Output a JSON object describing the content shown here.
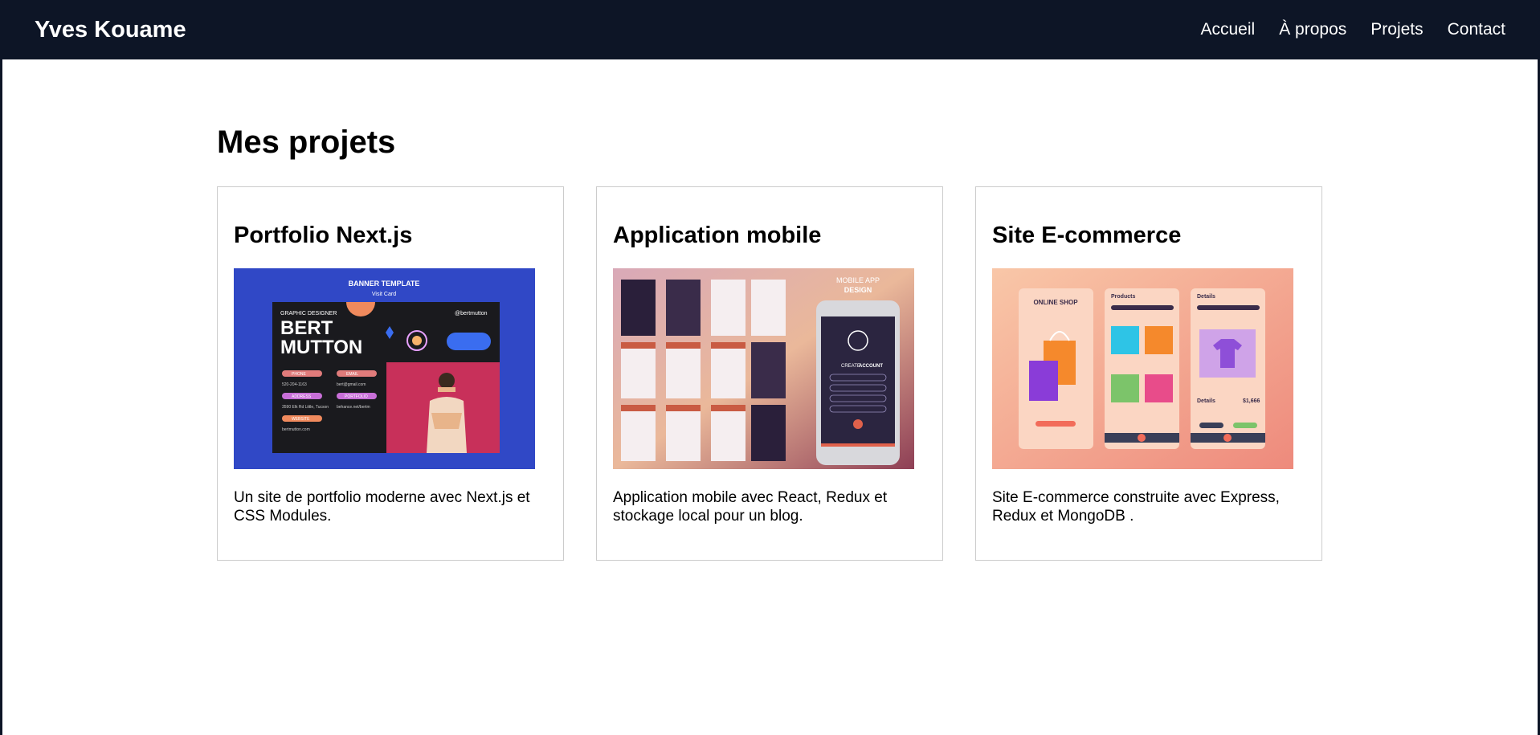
{
  "header": {
    "brand": "Yves Kouame",
    "nav": [
      {
        "label": "Accueil"
      },
      {
        "label": "À propos"
      },
      {
        "label": "Projets"
      },
      {
        "label": "Contact"
      }
    ]
  },
  "projects": {
    "title": "Mes projets",
    "items": [
      {
        "title": "Portfolio Next.js",
        "description": "Un site de portfolio moderne avec Next.js et CSS Modules.",
        "image": {
          "banner_heading": "BANNER TEMPLATE",
          "banner_sub": "Visit Card",
          "role": "GRAPHIC DESIGNER",
          "name_line1": "BERT",
          "name_line2": "MUTTON",
          "handle": "@bertmutton",
          "field1": "PHONE",
          "field1_value": "520-204-1163",
          "field2": "EMAIL",
          "field2_value": "bert@gmail.com",
          "field3": "ADDRESS",
          "field3_value": "3590 Elk Rd Little, Tucson",
          "field4": "PORTFOLIO",
          "field4_value": "behance.net/bertm",
          "field5": "WEBSITE",
          "field5_value": "bertmutton.com"
        }
      },
      {
        "title": "Application mobile",
        "description": "Application mobile avec React, Redux et stockage local pour un blog.",
        "image": {
          "heading1": "MOBILE APP",
          "heading2": "DESIGN",
          "create1": "CREATE",
          "create2": "ACCOUNT"
        }
      },
      {
        "title": "Site E-commerce",
        "description": "Site E-commerce construite avec Express, Redux et MongoDB .",
        "image": {
          "screen1_title": "ONLINE SHOP",
          "screen2_title": "Products",
          "screen3_title": "Details",
          "price": "$1,666"
        }
      }
    ]
  },
  "colors": {
    "navbar": "#0d1526",
    "card_border": "#cccccc",
    "text": "#000000"
  }
}
